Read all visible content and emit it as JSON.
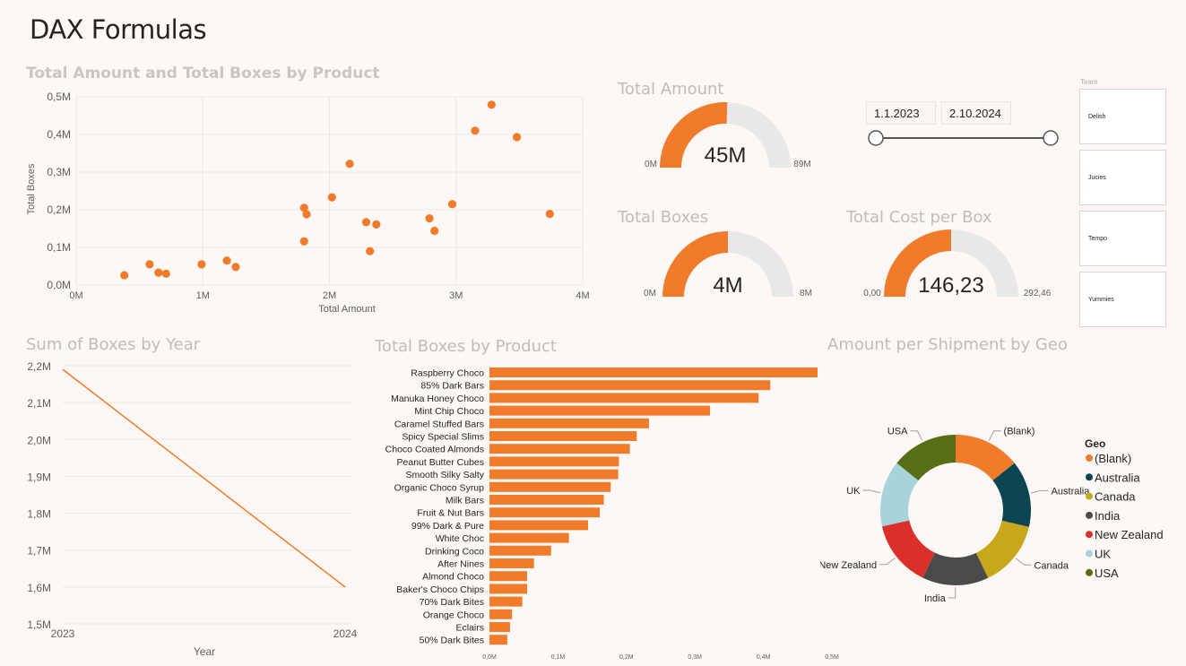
{
  "page": {
    "title": "DAX Formulas"
  },
  "scatter": {
    "title": "Total Amount and Total Boxes by Product",
    "xlabel": "Total Amount",
    "ylabel": "Total Boxes",
    "xticks": [
      "0M",
      "1M",
      "2M",
      "3M",
      "4M"
    ],
    "yticks": [
      "0,0M",
      "0,1M",
      "0,2M",
      "0,3M",
      "0,4M",
      "0,5M"
    ]
  },
  "gauge_amount": {
    "title": "Total Amount",
    "value": "45M",
    "min": "0M",
    "max": "89M",
    "fraction": 0.51
  },
  "gauge_boxes": {
    "title": "Total Boxes",
    "value": "4M",
    "min": "0M",
    "max": "8M",
    "fraction": 0.5
  },
  "gauge_cost": {
    "title": "Total Cost per Box",
    "value": "146,23",
    "min": "0,00",
    "max": "292,46",
    "fraction": 0.5
  },
  "date_slicer": {
    "start": "1.1.2023",
    "end": "2.10.2024"
  },
  "team_slicer": {
    "header": "Team",
    "items": [
      "Delish",
      "Jucies",
      "Tempo",
      "Yummies"
    ]
  },
  "line": {
    "title": "Sum of Boxes by Year",
    "xlabel": "Year",
    "xticks": [
      "2023",
      "2024"
    ],
    "yticks": [
      "1,5M",
      "1,6M",
      "1,7M",
      "1,8M",
      "1,9M",
      "2,0M",
      "2,1M",
      "2,2M"
    ]
  },
  "bars": {
    "title": "Total Boxes by Product",
    "xticks": [
      "0,0M",
      "0,1M",
      "0,2M",
      "0,3M",
      "0,4M",
      "0,5M"
    ]
  },
  "donut": {
    "title": "Amount per Shipment by Geo",
    "legend_title": "Geo"
  },
  "colors": {
    "accent": "#f07b2a",
    "track": "#e8e8e8"
  },
  "chart_data": [
    {
      "type": "scatter",
      "title": "Total Amount and Total Boxes by Product",
      "xlabel": "Total Amount",
      "ylabel": "Total Boxes",
      "xlim": [
        0,
        4000000
      ],
      "ylim": [
        0,
        500000
      ],
      "points": [
        [
          380000,
          26000
        ],
        [
          580000,
          55000
        ],
        [
          650000,
          33000
        ],
        [
          710000,
          30000
        ],
        [
          990000,
          55000
        ],
        [
          1190000,
          65000
        ],
        [
          1260000,
          48000
        ],
        [
          1800000,
          205000
        ],
        [
          1820000,
          188000
        ],
        [
          1800000,
          116000
        ],
        [
          2020000,
          233000
        ],
        [
          2160000,
          322000
        ],
        [
          2290000,
          167000
        ],
        [
          2320000,
          90000
        ],
        [
          2370000,
          161000
        ],
        [
          2790000,
          177000
        ],
        [
          2830000,
          144000
        ],
        [
          2970000,
          215000
        ],
        [
          3150000,
          410000
        ],
        [
          3280000,
          479000
        ],
        [
          3480000,
          393000
        ],
        [
          3740000,
          189000
        ]
      ]
    },
    {
      "type": "line",
      "title": "Sum of Boxes by Year",
      "xlabel": "Year",
      "x": [
        "2023",
        "2024"
      ],
      "values": [
        2190000,
        1600000
      ],
      "ylim": [
        1500000,
        2200000
      ]
    },
    {
      "type": "bar",
      "title": "Total Boxes by Product",
      "categories": [
        "Raspberry Choco",
        "85% Dark Bars",
        "Manuka Honey Choco",
        "Mint Chip Choco",
        "Caramel Stuffed Bars",
        "Spicy Special Slims",
        "Choco Coated Almonds",
        "Peanut Butter Cubes",
        "Smooth Silky Salty",
        "Organic Choco Syrup",
        "Milk Bars",
        "Fruit & Nut Bars",
        "99% Dark & Pure",
        "White Choc",
        "Drinking Coco",
        "After Nines",
        "Almond Choco",
        "Baker's Choco Chips",
        "70% Dark Bites",
        "Orange Choco",
        "Eclairs",
        "50% Dark Bites"
      ],
      "values": [
        479000,
        410000,
        393000,
        322000,
        233000,
        215000,
        205000,
        189000,
        188000,
        177000,
        167000,
        161000,
        144000,
        116000,
        90000,
        65000,
        55000,
        55000,
        48000,
        33000,
        30000,
        26000
      ],
      "xlim": [
        0,
        500000
      ]
    },
    {
      "type": "pie",
      "title": "Amount per Shipment by Geo",
      "legend_title": "Geo",
      "labels": [
        "(Blank)",
        "Australia",
        "Canada",
        "India",
        "New Zealand",
        "UK",
        "USA"
      ],
      "values": [
        14.3,
        14.3,
        14.3,
        14.3,
        14.3,
        14.2,
        14.3
      ],
      "colors": [
        "#f07b2a",
        "#0b4552",
        "#c7a81b",
        "#4a4a4a",
        "#d9302b",
        "#a7d3da",
        "#566f17"
      ]
    }
  ]
}
